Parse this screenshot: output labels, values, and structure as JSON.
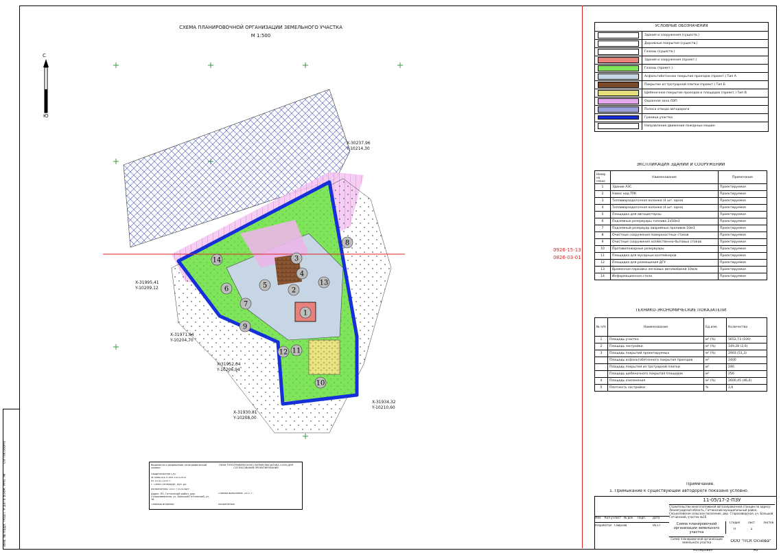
{
  "drawing": {
    "title": "СХЕМА ПЛАНИРОВОЧНОЙ ОРГАНИЗАЦИИ ЗЕМЕЛЬНОГО УЧАСТКА",
    "scale": "М 1:500",
    "north": "С",
    "south": "Ю",
    "section_line": [
      "0926-15-13",
      "0826-03-01"
    ]
  },
  "coordinates": [
    {
      "x": "X-30237,96",
      "y": "Y-10214,30"
    },
    {
      "x": "X-31995,41",
      "y": "Y-10209,12"
    },
    {
      "x": "X-31971,94",
      "y": "Y-10204,70"
    },
    {
      "x": "X-31952,04",
      "y": "Y-10206,94"
    },
    {
      "x": "X-31930,81",
      "y": "Y-10208,00"
    },
    {
      "x": "X-31934,32",
      "y": "Y-10210,60"
    }
  ],
  "site_labels": [
    "1",
    "2",
    "3",
    "4",
    "5",
    "6",
    "7",
    "8",
    "9",
    "10",
    "11",
    "12",
    "13",
    "14"
  ],
  "legend": {
    "title": "УСЛОВНЫЕ ОБОЗНАЧЕНИЯ",
    "items": [
      {
        "label": "Здания и сооружения (существ.)",
        "color": "#ffffff"
      },
      {
        "label": "Дорожные покрытия (существ.)",
        "color": "#ffffff"
      },
      {
        "label": "Газоны (существ.)",
        "color": "#ffffff"
      },
      {
        "label": "Здания и сооружения (проект.)",
        "color": "#e8807c"
      },
      {
        "label": "Газоны (проект.)",
        "color": "#7ee55a"
      },
      {
        "label": "Асфальтобетонное покрытие проездов (проект.) Тип А",
        "color": "#c7d6e4"
      },
      {
        "label": "Покрытие из тротуарной плитки (проект.) Тип Б",
        "color": "#7a4a2a"
      },
      {
        "label": "Щебеночное покрытие проездов и площадок (проект.) Тип В",
        "color": "#e6e07a"
      },
      {
        "label": "Охранная зона ЛЭП",
        "color": "#e6a8ec"
      },
      {
        "label": "Полоса отвода автодороги",
        "color": "#9aa2d8"
      },
      {
        "label": "Граница участка",
        "color": "#1530d8"
      },
      {
        "label": "Направление движения пожарных машин",
        "color": "#ffffff"
      }
    ]
  },
  "explication": {
    "title": "ЭКСПЛИКАЦИЯ ЗДАНИЙ И СООРУЖЕНИЙ",
    "headers": [
      "Номер на плане",
      "Наименование",
      "Примечание"
    ],
    "rows": [
      [
        "1",
        "Здание АЗС",
        "Проектируемое"
      ],
      [
        "2",
        "Навес над ТРК",
        "Проектируемое"
      ],
      [
        "3",
        "Топливораздаточная колонка (4 шт. одна)",
        "Проектируемое"
      ],
      [
        "4",
        "Топливораздаточная колонка (4 шт. одна)",
        "Проектируемое"
      ],
      [
        "5",
        "Площадка для автоцистерны",
        "Проектируемое"
      ],
      [
        "6",
        "Подземные резервуары топлива 2х50м3",
        "Проектируемое"
      ],
      [
        "7",
        "Подземный резервуар аварийных проливов 10м3",
        "Проектируемое"
      ],
      [
        "8",
        "Очистные сооружения поверхностных стоков",
        "Проектируемое"
      ],
      [
        "9",
        "Очистные сооружения хозяйственно-бытовых стоков",
        "Проектируемое"
      ],
      [
        "10",
        "Противопожарные резервуары",
        "Проектируемое"
      ],
      [
        "11",
        "Площадка для мусорных контейнеров",
        "Проектируемое"
      ],
      [
        "12",
        "Площадка для размещения ДГУ",
        "Проектируемое"
      ],
      [
        "13",
        "Временная парковка легковых автомобилей 10м/м",
        "Проектируемое"
      ],
      [
        "14",
        "Информационная стела",
        "Проектируемое"
      ]
    ]
  },
  "tep": {
    "title": "ТЕХНИКО-ЭКОНОМИЧЕСКИЕ ПОКАЗАТЕЛИ",
    "headers": [
      "№ п/п",
      "Наименование",
      "Ед.изм.",
      "Количество"
    ],
    "rows": [
      [
        "1",
        "Площадь участка",
        "м² (%)",
        "5652,73 (100)"
      ],
      [
        "2",
        "Площадь застройки",
        "м² (%)",
        "149,28 (2,6)"
      ],
      [
        "3",
        "Площадь покрытий проектируемых",
        "м² (%)",
        "2903 (51,3)"
      ],
      [
        "",
        "Площадь асфальтобетонного покрытия проездов",
        "м²",
        "2400"
      ],
      [
        "",
        "Площадь покрытия из тротуарной плитки",
        "м²",
        "246"
      ],
      [
        "",
        "Площадь щебеночного покрытия площадок",
        "м²",
        "256"
      ],
      [
        "4",
        "Площадь озеленения",
        "м² (%)",
        "2600,45 (46,0)"
      ],
      [
        "5",
        "Плотность застройки",
        "%",
        "2,6"
      ]
    ]
  },
  "notes": {
    "heading": "Примечание.",
    "text": "1. Примыкание к существующей автодороге показано условно."
  },
  "title_block": {
    "code": "11-05/17-2-ПЗУ",
    "description": "Строительство многотопливной автозаправочной станции по адресу: Ленинградская область, Гатчинский муниципальный район, Сяськелевское сельское поселение, дер. Старосиверская, уч. Большой Гатчинский, участок №16",
    "columns": [
      "Изм.",
      "Кол.уч",
      "Лист",
      "№ док.",
      "Подп.",
      "Дата"
    ],
    "role": "Разработал",
    "name": "Смирнов",
    "date": "06.17",
    "sheet_title": "Схема планировочной организации земельного участка",
    "stage_headers": [
      "Стадия",
      "Лист",
      "Листов"
    ],
    "stage_values": [
      "П",
      "1",
      ""
    ],
    "subtitle": "Схема планировочной организации земельного участка",
    "company": "ООО \"ПСК Основа\"",
    "copied": "Копировал",
    "format": "А1"
  },
  "stamp_box": {
    "title_left": "Ведомости и разрешения топографической съемки",
    "title_right": "ПЛАН ТОПОГРАФИЧЕСКОЙ СЪЕМКИ МАСШТАБА 1:500 ДЛЯ СОГЛАСОВАНИЯ ПРОЕКТИРОВАНИЯ",
    "lines": [
      "Свидетельство СРО",
      "№ 0986-0/4-Л-005-10212012",
      "от 25.02.2015 г.",
      "г. Санкт-Петербург, бул. ДЕ",
      "Исполнитель: ООО \"ГЕОПЛАН\"",
      "Адрес: ЛО, Гатчинский район, дер. Старосиверская, уч. Большой Гатчинский, уч. 16",
      "Съемка выполнена: 2017 г.",
      "Главный инженер",
      "Исполнитель"
    ]
  },
  "side_stamps": [
    "Согласовано",
    "Инв. № подл.",
    "Подп. и дата",
    "Взам. инв. №"
  ]
}
